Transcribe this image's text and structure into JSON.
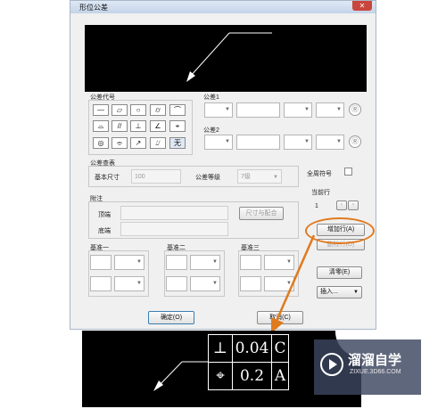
{
  "dialog": {
    "title": "形位公差",
    "close_symbol": "✕"
  },
  "sections": {
    "symbol_group": "公差代号",
    "tolerance1": "公差1",
    "tolerance2": "公差2",
    "lookup": "公差查表",
    "annotation": "附注",
    "datum1": "基准一",
    "datum2": "基准二",
    "datum3": "基准三"
  },
  "symbols": [
    "—",
    "▱",
    "○",
    "⌭",
    "⌒",
    "⌓",
    "//",
    "⊥",
    "∠",
    "⌖",
    "◎",
    "⌯",
    "↗",
    "⌰",
    "无"
  ],
  "lookup": {
    "basic_size_label": "基本尺寸",
    "basic_size_value": "100",
    "grade_label": "公差等级",
    "grade_value": "7级"
  },
  "tolerance_r_symbol": "Ⓡ",
  "annotation": {
    "top_label": "顶端",
    "bottom_label": "底端",
    "size_fit_button": "尺寸与配合"
  },
  "all_around": {
    "label": "全周符号"
  },
  "current_row": {
    "label": "当前行",
    "value": "1"
  },
  "buttons": {
    "add_row": "增加行(A)",
    "delete_row": "删除行(D)",
    "clear": "清零(E)",
    "insert": "插入...",
    "ok": "确定(O)",
    "cancel": "取消(C)"
  },
  "result_frame": {
    "row1": {
      "symbol": "⊥",
      "value": "0.04",
      "datum": "C"
    },
    "row2": {
      "symbol": "⌖",
      "value": "0.2",
      "datum": "A"
    }
  },
  "watermark": {
    "name": "溜溜自学",
    "url": "ZIXUE.3D66.COM"
  },
  "colors": {
    "annotation_circle": "#e07a1f",
    "arrow": "#e07a1f",
    "cad_background": "#000000",
    "close_button": "#c9463d"
  }
}
